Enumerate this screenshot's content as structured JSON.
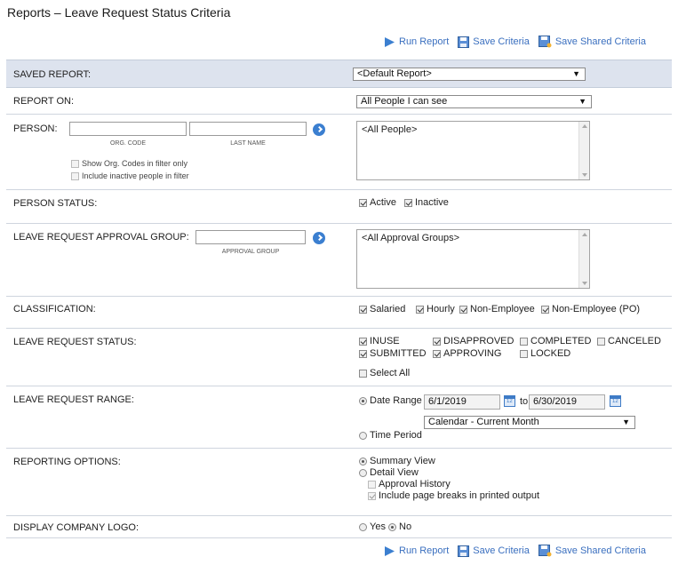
{
  "title": "Reports – Leave Request Status Criteria",
  "toolbar": {
    "run_report": "Run Report",
    "save_criteria": "Save Criteria",
    "save_shared_criteria": "Save Shared Criteria"
  },
  "saved_report": {
    "label": "SAVED REPORT:",
    "value": "<Default Report>"
  },
  "report_on": {
    "label": "REPORT ON:",
    "value": "All People I can see"
  },
  "person": {
    "label": "PERSON:",
    "org_code_caption": "ORG. CODE",
    "last_name_caption": "LAST NAME",
    "show_org_codes": "Show Org. Codes in filter only",
    "include_inactive": "Include inactive people in filter",
    "list_value": "<All People>"
  },
  "person_status": {
    "label": "PERSON STATUS:",
    "active": "Active",
    "inactive": "Inactive"
  },
  "approval_group": {
    "label": "LEAVE REQUEST APPROVAL GROUP:",
    "caption": "APPROVAL GROUP",
    "list_value": "<All Approval Groups>"
  },
  "classification": {
    "label": "CLASSIFICATION:",
    "salaried": "Salaried",
    "hourly": "Hourly",
    "non_employee": "Non-Employee",
    "non_employee_po": "Non-Employee (PO)"
  },
  "status": {
    "label": "LEAVE REQUEST STATUS:",
    "inuse": "INUSE",
    "disapproved": "DISAPPROVED",
    "completed": "COMPLETED",
    "canceled": "CANCELED",
    "submitted": "SUBMITTED",
    "approving": "APPROVING",
    "locked": "LOCKED",
    "select_all": "Select All"
  },
  "range": {
    "label": "LEAVE REQUEST RANGE:",
    "date_range": "Date Range",
    "from": "6/1/2019",
    "to_label": "to",
    "to": "6/30/2019",
    "period_select": "Calendar - Current Month",
    "time_period": "Time Period"
  },
  "reporting_options": {
    "label": "REPORTING OPTIONS:",
    "summary": "Summary View",
    "detail": "Detail View",
    "approval_history": "Approval History",
    "page_breaks": "Include page breaks in printed output"
  },
  "logo": {
    "label": "DISPLAY COMPANY LOGO:",
    "yes": "Yes",
    "no": "No"
  },
  "colors": {
    "accent": "#3a6fbf",
    "saved_row_bg": "#dde3ee"
  }
}
